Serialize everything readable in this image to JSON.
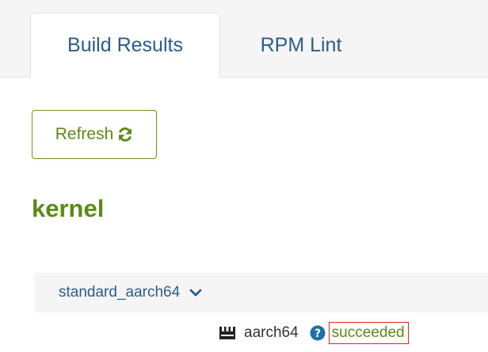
{
  "tabs": [
    {
      "label": "Build Results",
      "active": true
    },
    {
      "label": "RPM Lint",
      "active": false
    }
  ],
  "refresh": {
    "label": "Refresh",
    "icon": "refresh-icon"
  },
  "package": {
    "name": "kernel"
  },
  "repository": {
    "name": "standard_aarch64",
    "icon": "chevron-down-icon"
  },
  "build": {
    "arch": "aarch64",
    "arch_icon": "server-icon",
    "help_icon": "question-circle-icon",
    "status": "succeeded"
  },
  "colors": {
    "link": "#2b5c8a",
    "accent_green": "#5c8a17",
    "highlight_red": "#e0262b",
    "help_blue": "#1f6fa8"
  }
}
